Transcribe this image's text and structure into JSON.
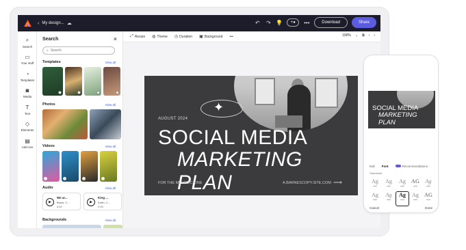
{
  "topbar": {
    "doc_name": "My design...",
    "download_label": "Download",
    "share_label": "Share",
    "more": "•••",
    "accent_color": "#5c5ce0"
  },
  "rail": {
    "items": [
      {
        "label": "Search",
        "icon": "search-icon"
      },
      {
        "label": "Your stuff",
        "icon": "folder-icon"
      },
      {
        "label": "Templates",
        "icon": "templates-icon"
      },
      {
        "label": "Media",
        "icon": "media-icon"
      },
      {
        "label": "Text",
        "icon": "text-icon"
      },
      {
        "label": "Elements",
        "icon": "elements-icon"
      },
      {
        "label": "Add-ons",
        "icon": "addons-icon"
      }
    ]
  },
  "panel": {
    "title": "Search",
    "search_placeholder": "Search",
    "view_all": "View all",
    "sections": {
      "templates": "Templates",
      "photos": "Photos",
      "videos": "Videos",
      "audio": "Audio",
      "backgrounds": "Backgrounds"
    },
    "audio_items": [
      {
        "title": "We ar...",
        "artist": "Brass, C...",
        "duration": "4:22"
      },
      {
        "title": "King ...",
        "artist": "Earth, C...",
        "duration": "2:15"
      }
    ]
  },
  "toolbar": {
    "resize": "Resize",
    "theme": "Theme",
    "duration": "Duration",
    "background": "Background",
    "more": "•••",
    "zoom": "100%"
  },
  "canvas": {
    "date": "AUGUST 2024",
    "title_line1": "SOCIAL MEDIA",
    "title_line2": "MARKETING PLAN",
    "footer_left": "FOR THE MELODIC LINE",
    "footer_right": "A.BARNESCOPY.SITE.COM"
  },
  "phone": {
    "tabs": [
      "Edit",
      "Font",
      "Recommendations"
    ],
    "subtitle": "Standards",
    "cancel": "Cancel",
    "done": "Done",
    "font_sample": "Ag",
    "font_sample_bold": "AG"
  }
}
